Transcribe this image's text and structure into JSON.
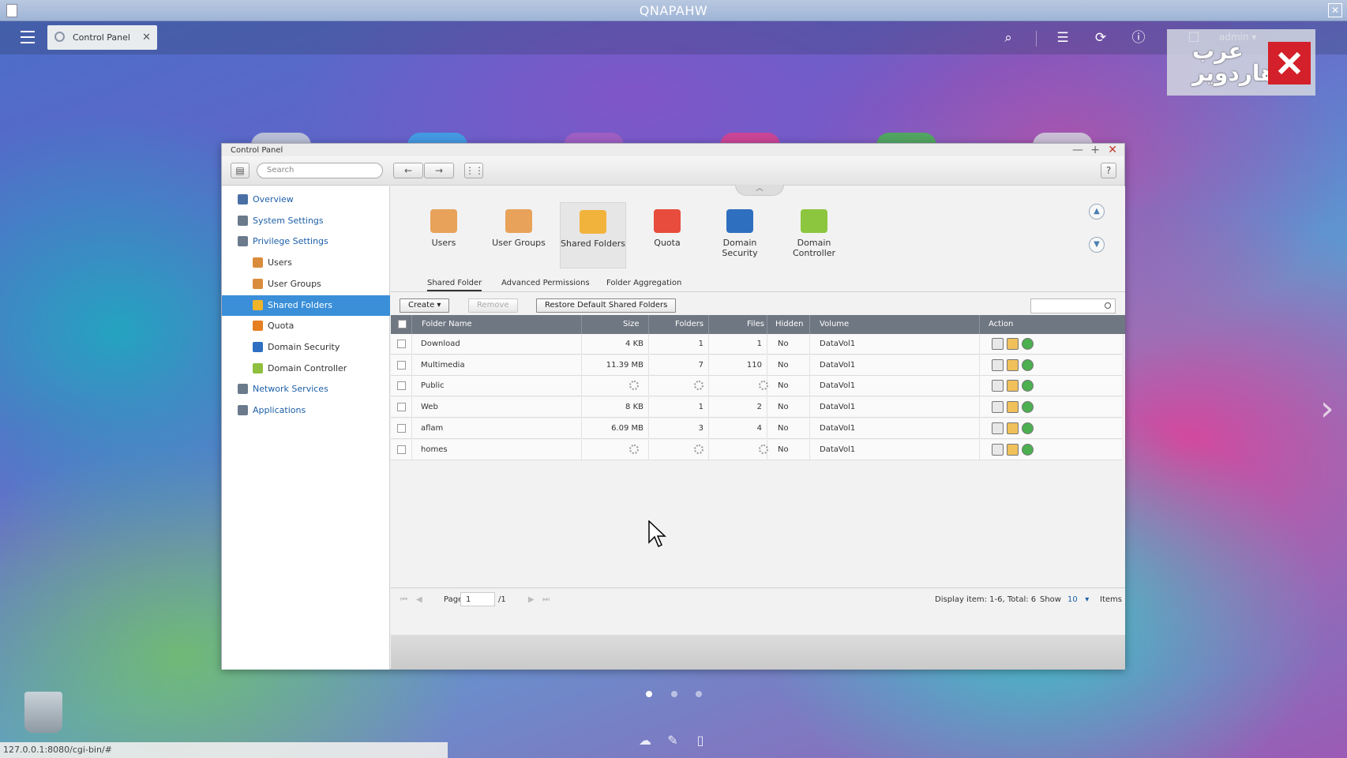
{
  "os": {
    "window_title": "QNAPAHW",
    "taskbar_tab": "Control Panel",
    "user": "admin",
    "status_url": "127.0.0.1:8080/cgi-bin/#"
  },
  "window": {
    "title": "Control Panel",
    "search_placeholder": "Search",
    "help_label": "?"
  },
  "sidebar": {
    "items": [
      {
        "label": "Overview",
        "level": "top",
        "icon": "overview-icon",
        "color": "#4a6fa5"
      },
      {
        "label": "System Settings",
        "level": "top",
        "icon": "gear-icon",
        "color": "#6b7a8c"
      },
      {
        "label": "Privilege Settings",
        "level": "top",
        "icon": "user-icon",
        "color": "#6b7a8c"
      },
      {
        "label": "Users",
        "level": "sub",
        "icon": "user-icon",
        "color": "#d98c3c"
      },
      {
        "label": "User Groups",
        "level": "sub",
        "icon": "user-group-icon",
        "color": "#d98c3c"
      },
      {
        "label": "Shared Folders",
        "level": "sub",
        "icon": "folder-icon",
        "color": "#f0b429",
        "active": true
      },
      {
        "label": "Quota",
        "level": "sub",
        "icon": "quota-icon",
        "color": "#e67e22"
      },
      {
        "label": "Domain Security",
        "level": "sub",
        "icon": "domain-security-icon",
        "color": "#2e6fc2"
      },
      {
        "label": "Domain Controller",
        "level": "sub",
        "icon": "domain-controller-icon",
        "color": "#8fbf3f"
      },
      {
        "label": "Network Services",
        "level": "top",
        "icon": "globe-icon",
        "color": "#6b7a8c"
      },
      {
        "label": "Applications",
        "level": "top",
        "icon": "apps-icon",
        "color": "#6b7a8c"
      }
    ]
  },
  "apps": [
    {
      "label": "Users",
      "icon": "users-icon",
      "color": "#e8a25a"
    },
    {
      "label": "User Groups",
      "icon": "user-groups-icon",
      "color": "#e8a25a"
    },
    {
      "label": "Shared Folders",
      "icon": "shared-folders-icon",
      "color": "#f2b33d",
      "selected": true
    },
    {
      "label": "Quota",
      "icon": "quota-icon",
      "color": "#e74c3c"
    },
    {
      "label": "Domain Security",
      "icon": "domain-security-icon",
      "color": "#2f6fbf"
    },
    {
      "label": "Domain Controller",
      "icon": "domain-controller-icon",
      "color": "#8cc63f"
    }
  ],
  "subtabs": [
    "Shared Folder",
    "Advanced Permissions",
    "Folder Aggregation"
  ],
  "actions": {
    "create": "Create",
    "remove": "Remove",
    "restore": "Restore Default Shared Folders"
  },
  "table": {
    "headers": [
      "Folder Name",
      "Size",
      "Folders",
      "Files",
      "Hidden",
      "Volume",
      "Action"
    ],
    "rows": [
      {
        "name": "Download",
        "size": "4 KB",
        "folders": "1",
        "files": "1",
        "hidden": "No",
        "volume": "DataVol1"
      },
      {
        "name": "Multimedia",
        "size": "11.39 MB",
        "folders": "7",
        "files": "110",
        "hidden": "No",
        "volume": "DataVol1"
      },
      {
        "name": "Public",
        "size": "",
        "folders": "",
        "files": "",
        "hidden": "No",
        "volume": "DataVol1",
        "loading": true
      },
      {
        "name": "Web",
        "size": "8 KB",
        "folders": "1",
        "files": "2",
        "hidden": "No",
        "volume": "DataVol1"
      },
      {
        "name": "aflam",
        "size": "6.09 MB",
        "folders": "3",
        "files": "4",
        "hidden": "No",
        "volume": "DataVol1"
      },
      {
        "name": "homes",
        "size": "",
        "folders": "",
        "files": "",
        "hidden": "No",
        "volume": "DataVol1",
        "loading": true
      }
    ]
  },
  "pager": {
    "page_label": "Page",
    "page_value": "1",
    "page_total": "/1",
    "display": "Display item: 1-6, Total: 6",
    "show_label": "Show",
    "show_value": "10",
    "items_label": "Items"
  }
}
